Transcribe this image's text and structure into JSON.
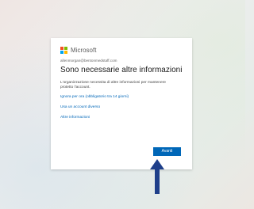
{
  "brand": {
    "name": "Microsoft",
    "logo_colors": [
      "#f25022",
      "#7fba00",
      "#00a4ef",
      "#ffb900"
    ]
  },
  "account": "allenmorgan@bentonmedstaff.com",
  "title": "Sono necessarie altre informazioni",
  "description": "L'organizzazione necessita di altre informazioni per mantenere protetto l'account.",
  "links": {
    "skip": "Ignora per ora (obbligatorio tra 14 giorni)",
    "other_account": "Usa un account diverso",
    "more_info": "Altre informazioni"
  },
  "next_button": "Avanti",
  "colors": {
    "accent": "#0067b8",
    "arrow": "#1f3f8a"
  },
  "icons": {
    "annotation": "up-arrow-icon"
  }
}
